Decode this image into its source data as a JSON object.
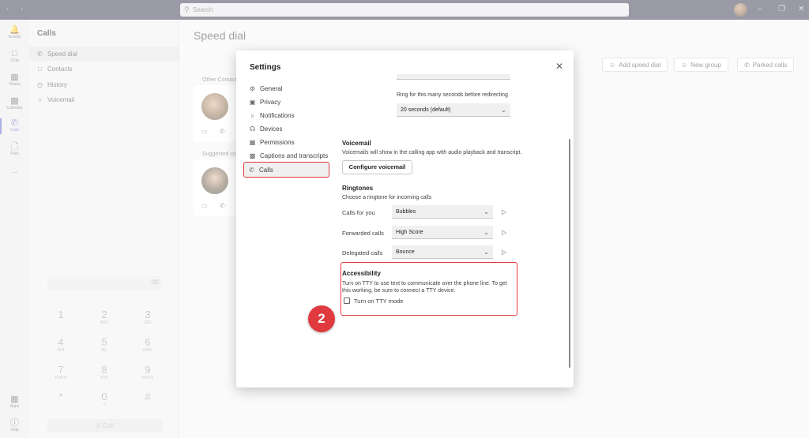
{
  "titlebar": {
    "search_placeholder": "Search",
    "nav_arrows": "‹ ›",
    "window_controls": [
      "–",
      "❐",
      "✕"
    ]
  },
  "rail": {
    "items": [
      {
        "label": "Activity",
        "icon": "bell-icon"
      },
      {
        "label": "Chat",
        "icon": "chat-icon"
      },
      {
        "label": "Teams",
        "icon": "teams-icon"
      },
      {
        "label": "Calendar",
        "icon": "calendar-icon"
      },
      {
        "label": "Calls",
        "icon": "phone-icon"
      },
      {
        "label": "Files",
        "icon": "file-icon"
      },
      {
        "label": "...",
        "icon": "more-icon"
      },
      {
        "label": "Apps",
        "icon": "apps-icon"
      },
      {
        "label": "Help",
        "icon": "help-icon"
      }
    ]
  },
  "calls_panel": {
    "title": "Calls",
    "items": [
      {
        "label": "Speed dial",
        "icon": "phone-icon"
      },
      {
        "label": "Contacts",
        "icon": "contacts-icon"
      },
      {
        "label": "History",
        "icon": "history-icon"
      },
      {
        "label": "Voicemail",
        "icon": "voicemail-icon"
      }
    ],
    "dialpad": [
      {
        "digit": "1",
        "letters": ""
      },
      {
        "digit": "2",
        "letters": "ABC"
      },
      {
        "digit": "3",
        "letters": "DEF"
      },
      {
        "digit": "4",
        "letters": "GHI"
      },
      {
        "digit": "5",
        "letters": "JKL"
      },
      {
        "digit": "6",
        "letters": "MNO"
      },
      {
        "digit": "7",
        "letters": "PQRS"
      },
      {
        "digit": "8",
        "letters": "TUV"
      },
      {
        "digit": "9",
        "letters": "WXYZ"
      },
      {
        "digit": "*",
        "letters": ""
      },
      {
        "digit": "0",
        "letters": "+"
      },
      {
        "digit": "#",
        "letters": ""
      }
    ],
    "call_button": "Call"
  },
  "main": {
    "title": "Speed dial",
    "toolbar": {
      "add_speed_dial": "Add speed dial",
      "new_group": "New group",
      "parked_calls": "Parked calls"
    },
    "sections": {
      "other_contacts": "Other Contacts",
      "suggested": "Suggested con"
    }
  },
  "settings": {
    "title": "Settings",
    "nav": [
      {
        "label": "General",
        "icon": "gear-icon"
      },
      {
        "label": "Privacy",
        "icon": "lock-icon"
      },
      {
        "label": "Notifications",
        "icon": "bell-icon"
      },
      {
        "label": "Devices",
        "icon": "headset-icon"
      },
      {
        "label": "Permissions",
        "icon": "permissions-icon"
      },
      {
        "label": "Captions and transcripts",
        "icon": "captions-icon"
      },
      {
        "label": "Calls",
        "icon": "phone-icon"
      }
    ],
    "ring_label": "Ring for this many seconds before redirecting",
    "ring_value": "20 seconds (default)",
    "voicemail": {
      "heading": "Voicemail",
      "desc": "Voicemails will show in the calling app with audio playback and transcript.",
      "button": "Configure voicemail"
    },
    "ringtones": {
      "heading": "Ringtones",
      "desc": "Choose a ringtone for incoming calls",
      "rows": [
        {
          "label": "Calls for you",
          "value": "Bubbles"
        },
        {
          "label": "Forwarded calls",
          "value": "High Score"
        },
        {
          "label": "Delegated calls",
          "value": "Bounce"
        }
      ]
    },
    "accessibility": {
      "heading": "Accessibility",
      "desc": "Turn on TTY to use text to communicate over the phone line. To get this working, be sure to connect a TTY device.",
      "checkbox_label": "Turn on TTY mode"
    },
    "step_badge": "2"
  },
  "colors": {
    "highlight": "#e0393e",
    "titlebar": "#33344a",
    "accent": "#5b5fc7"
  }
}
